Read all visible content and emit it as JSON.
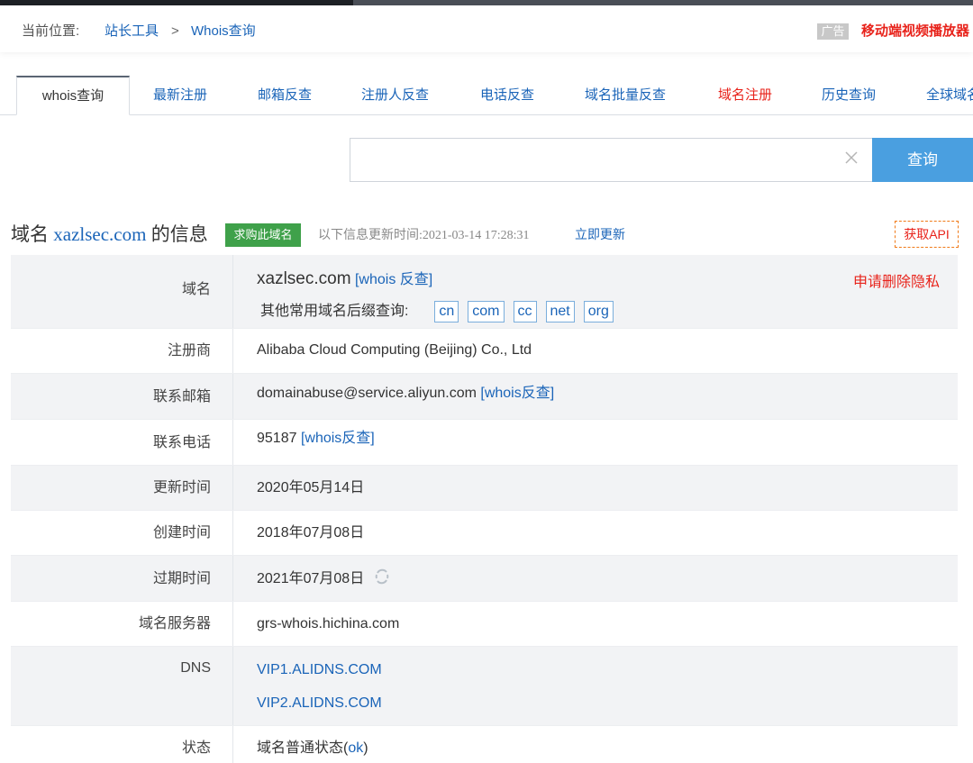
{
  "breadcrumb": {
    "prefix": "当前位置:",
    "link1": "站长工具",
    "sep": ">",
    "link2": "Whois查询"
  },
  "ad": {
    "badge": "广告",
    "text": "移动端视频播放器"
  },
  "tabs": [
    {
      "label": "whois查询",
      "active": true
    },
    {
      "label": "最新注册"
    },
    {
      "label": "邮箱反查"
    },
    {
      "label": "注册人反查"
    },
    {
      "label": "电话反查"
    },
    {
      "label": "域名批量反查"
    },
    {
      "label": "域名注册",
      "color": "red"
    },
    {
      "label": "历史查询"
    },
    {
      "label": "全球域名"
    }
  ],
  "search": {
    "value": "",
    "button": "查询"
  },
  "info": {
    "title_pre": "域名",
    "domain": "xazlsec.com",
    "title_post": "的信息",
    "buy_badge": "求购此域名",
    "updated_label": "以下信息更新时间:2021-03-14 17:28:31",
    "refresh_link": "立即更新",
    "api_button": "获取API"
  },
  "table": {
    "domain_key": "域名",
    "domain_val": "xazlsec.com",
    "domain_link": "[whois 反查]",
    "privacy_link": "申请删除隐私",
    "suffix_label": "其他常用域名后缀查询:",
    "suffixes": [
      "cn",
      "com",
      "cc",
      "net",
      "org"
    ],
    "registrar_key": "注册商",
    "registrar_val": "Alibaba Cloud Computing (Beijing) Co., Ltd",
    "email_key": "联系邮箱",
    "email_val": "domainabuse@service.aliyun.com",
    "email_link": "[whois反查]",
    "phone_key": "联系电话",
    "phone_val": "95187",
    "phone_link": "[whois反查]",
    "updated_key": "更新时间",
    "updated_val": "2020年05月14日",
    "created_key": "创建时间",
    "created_val": "2018年07月08日",
    "expires_key": "过期时间",
    "expires_val": "2021年07月08日",
    "server_key": "域名服务器",
    "server_val": "grs-whois.hichina.com",
    "dns_key": "DNS",
    "dns_vals": [
      "VIP1.ALIDNS.COM",
      "VIP2.ALIDNS.COM"
    ],
    "status_key": "状态",
    "status_pre": "域名普通状态(",
    "status_code": "ok",
    "status_post": ")"
  },
  "colors": {
    "link": "#1a64b8",
    "accent_red": "#e8231b",
    "button_blue": "#4a9fe0",
    "badge_green": "#3fa14a",
    "row_gray": "#f2f3f5"
  }
}
